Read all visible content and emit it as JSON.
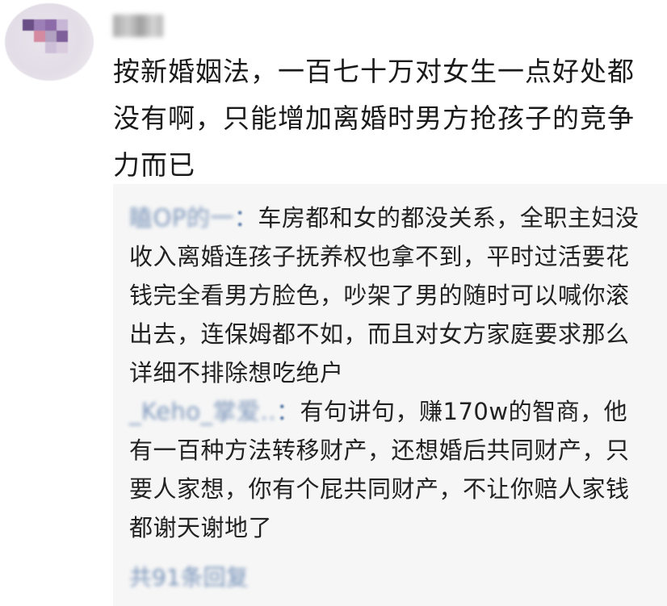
{
  "comment": {
    "username": "富婆",
    "text": "按新婚姻法，一百七十万对女生一点好处都没有啊，只能增加离婚时男方抢孩子的竞争力而已"
  },
  "replies": [
    {
      "username": "瞌OP的一",
      "separator": "：",
      "text": "车房都和女的都没关系，全职主妇没收入离婚连孩子抚养权也拿不到，平时过活要花钱完全看男方脸色，吵架了男的随时可以喊你滚出去，连保姆都不如，而且对女方家庭要求那么详细不排除想吃绝户"
    },
    {
      "username": "_Keho_掌爱..",
      "separator": "：",
      "text": "有句讲句，赚170w的智商，他有一百种方法转移财产，还想婚后共同财产，只要人家想，你有个屁共同财产，不让你赔人家钱都谢天谢地了"
    }
  ],
  "more_replies_label": "共91条回复",
  "colors": {
    "link_blue": "#4a6fa3",
    "reply_background": "#f6f6f6",
    "text": "#1a1a1a"
  }
}
